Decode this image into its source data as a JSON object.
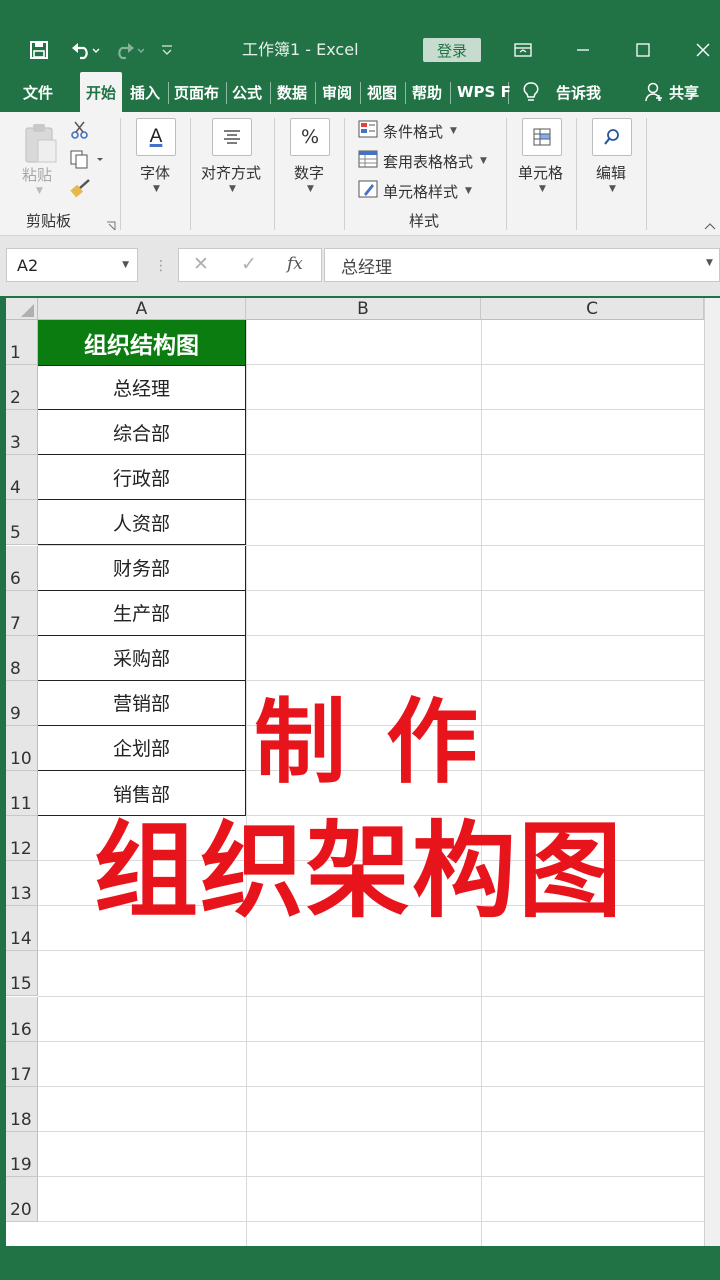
{
  "titlebar": {
    "title": "工作簿1  -  Excel",
    "login": "登录",
    "icons": [
      "save-icon",
      "undo-icon",
      "redo-icon",
      "customize-icon",
      "ribbon-display-icon",
      "minimize-icon",
      "maximize-icon",
      "close-icon"
    ]
  },
  "tabs": {
    "file": "文件",
    "home": "开始",
    "insert": "插入",
    "page_layout": "页面布",
    "formulas": "公式",
    "data": "数据",
    "review": "审阅",
    "view": "视图",
    "help": "帮助",
    "wps": "WPS F",
    "tell_me": "告诉我",
    "share": "共享"
  },
  "ribbon": {
    "paste": "粘贴",
    "clipboard": "剪贴板",
    "font": "字体",
    "alignment": "对齐方式",
    "number": "数字",
    "number_symbol": "%",
    "conditional_format": "条件格式",
    "table_format": "套用表格格式",
    "cell_style": "单元格样式",
    "styles": "样式",
    "cells": "单元格",
    "editing": "编辑",
    "font_letter": "A"
  },
  "formula_bar": {
    "name_box": "A2",
    "fx": "fx",
    "content": "总经理"
  },
  "sheet": {
    "columns": [
      "A",
      "B",
      "C"
    ],
    "rows": [
      "1",
      "2",
      "3",
      "4",
      "5",
      "6",
      "7",
      "8",
      "9",
      "10",
      "11",
      "12",
      "13",
      "14",
      "15",
      "16",
      "17",
      "18",
      "19",
      "20"
    ],
    "header_cell": "组织结构图",
    "header_color": "#0b7d10",
    "cells_a": [
      "总经理",
      "综合部",
      "行政部",
      "人资部",
      "财务部",
      "生产部",
      "采购部",
      "营销部",
      "企划部",
      "销售部"
    ]
  },
  "overlay": {
    "line1": "制 作",
    "line2": "组织架构图",
    "color": "#e8141c"
  },
  "theme": {
    "excel_green": "#217346"
  }
}
